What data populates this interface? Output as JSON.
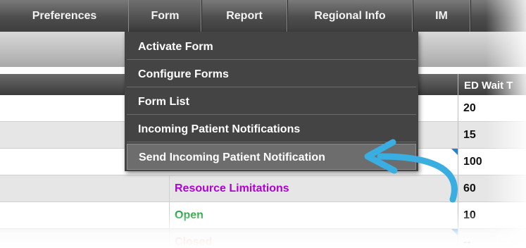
{
  "menubar": {
    "tabs": [
      {
        "label": "Preferences"
      },
      {
        "label": "Form"
      },
      {
        "label": "Report"
      },
      {
        "label": "Regional Info"
      },
      {
        "label": "IM"
      }
    ]
  },
  "dropdown": {
    "items": [
      {
        "label": "Activate Form"
      },
      {
        "label": "Configure Forms"
      },
      {
        "label": "Form List"
      },
      {
        "label": "Incoming Patient Notifications"
      },
      {
        "label": "Send Incoming Patient Notification"
      }
    ]
  },
  "table": {
    "column_header": "ED Wait T",
    "rows": [
      {
        "status": "",
        "value": "20"
      },
      {
        "status": "",
        "value": "15"
      },
      {
        "status": "",
        "value": "100"
      },
      {
        "status": "Resource Limitations",
        "value": "60"
      },
      {
        "status": "Open",
        "value": "10"
      },
      {
        "status": "Closed",
        "value": "--"
      }
    ]
  },
  "colors": {
    "resource_limitations": "#b000d6",
    "open": "#1fa53a",
    "closed": "#e0503a",
    "callout_arrow": "#3aaee0"
  },
  "annotation": {
    "icon": "curved-arrow-icon"
  }
}
